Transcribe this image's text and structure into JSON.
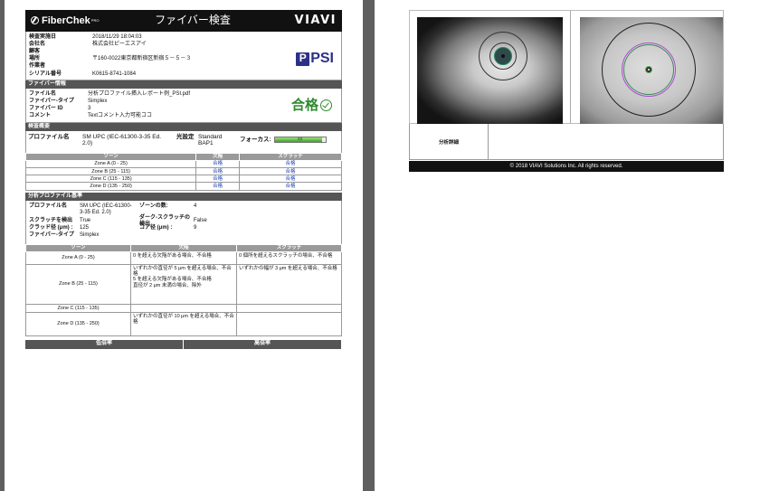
{
  "header": {
    "brand": "FiberChek",
    "brand_sup": "PRO",
    "title": "ファイバー検査",
    "company_logo": "VIAVI"
  },
  "info": [
    {
      "k": "検査実施日",
      "v": "2018/11/29 18:04:03"
    },
    {
      "k": "会社名",
      "v": "株式会社ピーエスアイ"
    },
    {
      "k": "顧客",
      "v": ""
    },
    {
      "k": "場所",
      "v": "〒160-0022東京都新宿区新宿５－５－３"
    },
    {
      "k": "作業者",
      "v": ""
    },
    {
      "k": "シリアル番号",
      "v": "K0615-8741-1084"
    }
  ],
  "psi_logo": {
    "mark": "P",
    "text": "PSI"
  },
  "fiber_section": "ファイバー情報",
  "fiber": [
    {
      "k": "ファイル名",
      "v": "分析プロファイル挿入レポート例_PSI.pdf"
    },
    {
      "k": "ファイバー-タイプ",
      "v": "Simplex"
    },
    {
      "k": "ファイバー ID",
      "v": "3"
    },
    {
      "k": "コメント",
      "v": "Textコメント入力可能ココ"
    }
  ],
  "result": "合格",
  "summary_section": "検査概要",
  "summary": {
    "profile_label": "プロファイル名",
    "profile_value": "SM UPC (IEC-61300-3-35 Ed. 2.0)",
    "light_label": "光設定",
    "light_value": "Standard BAP1",
    "focus_label": "フォーカス:",
    "focus_value": "93",
    "focus_fraction": 0.93
  },
  "zone_headers": [
    "ゾーン",
    "欠陥",
    "スクラッチ"
  ],
  "zones": [
    {
      "name": "Zone A (0 - 25)",
      "defect": "合格",
      "scratch": "合格"
    },
    {
      "name": "Zone B (25 - 115)",
      "defect": "合格",
      "scratch": "合格"
    },
    {
      "name": "Zone C (115 - 135)",
      "defect": "合格",
      "scratch": "合格"
    },
    {
      "name": "Zone D (135 - 250)",
      "defect": "合格",
      "scratch": "合格"
    }
  ],
  "profile_section": "分析プロファイル基準",
  "profile": {
    "rows": [
      {
        "k": "プロファイル名",
        "v": "SM UPC (IEC-61300-3-35 Ed. 2.0)",
        "k2": "ゾーンの数:",
        "v2": "4"
      },
      {
        "k": "スクラッチを検出",
        "v": "True",
        "k2": "ダーク-スクラッチの検出",
        "v2": "False"
      },
      {
        "k": "クラッド径 (μm) :",
        "v": "125",
        "k2": "コア径 (μm) :",
        "v2": "9"
      },
      {
        "k": "ファイバー-タイプ",
        "v": "Simplex",
        "k2": "",
        "v2": ""
      }
    ]
  },
  "criteria_headers": [
    "ゾーン",
    "欠陥",
    "スクラッチ"
  ],
  "criteria": [
    {
      "zone": "Zone A (0 - 25)",
      "defect": "0 を超える欠陥がある場合、不合格",
      "scratch": "0 個所を超えるスクラッチの場合、不合格"
    },
    {
      "zone": "Zone B (25 - 115)",
      "defect": "いずれかの直径が 5 μm を超える場合、不合格\n5 を超える欠陥がある場合、不合格\n直径が 2 μm 未満の場合、除外",
      "scratch": "いずれかの幅が 3 μm を超える場合、不合格"
    },
    {
      "zone": "Zone C (115 - 135)",
      "defect": "",
      "scratch": ""
    },
    {
      "zone": "Zone D (135 - 250)",
      "defect": "いずれかの直径が 10 μm を超える場合、不合格",
      "scratch": ""
    }
  ],
  "footer_tabs": [
    "低倍率",
    "高倍率"
  ],
  "page2": {
    "analysis_label": "分析詳細",
    "copyright": "© 2018 VIAVI Solutions Inc. All rights reserved."
  },
  "colors": {
    "pass_green": "#2e8b2e",
    "pass_link": "#1a3fb0",
    "psi_blue": "#2c3187"
  }
}
